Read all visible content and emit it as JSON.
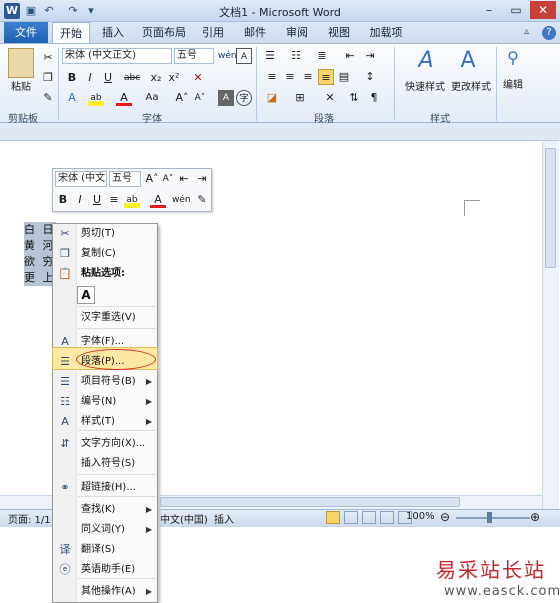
{
  "window": {
    "title": "文档1 - Microsoft Word",
    "quick_access": [
      "save-icon",
      "undo-icon",
      "redo-icon"
    ],
    "controls": [
      "minimize",
      "maximize",
      "close"
    ]
  },
  "tabs": {
    "file": "文件",
    "items": [
      "开始",
      "插入",
      "页面布局",
      "引用",
      "邮件",
      "审阅",
      "视图",
      "加载项"
    ],
    "active": "开始"
  },
  "ribbon": {
    "clipboard": {
      "label": "剪贴板",
      "paste": "粘贴"
    },
    "font": {
      "label": "字体",
      "name": "宋体 (中文正文)",
      "size": "五号"
    },
    "paragraph": {
      "label": "段落"
    },
    "styles": {
      "label": "样式",
      "quick": "快速样式",
      "change": "更改样式"
    },
    "editing": {
      "label": "编辑"
    }
  },
  "document": {
    "lines": [
      "白 日",
      "黄 河",
      "欲 穷",
      "更 上"
    ]
  },
  "mini_toolbar": {
    "font": "宋体 (中文",
    "size": "五号"
  },
  "context_menu": {
    "items": [
      {
        "label": "剪切(T)",
        "icon": "scissors-icon"
      },
      {
        "label": "复制(C)",
        "icon": "copy-icon"
      },
      {
        "label": "粘贴选项:",
        "icon": "paste-icon"
      },
      {
        "label": "A",
        "icon": "paste-keep-text-icon"
      },
      {
        "label": "汉字重选(V)",
        "icon": ""
      },
      {
        "label": "字体(F)...",
        "icon": "font-icon"
      },
      {
        "label": "段落(P)...",
        "icon": "paragraph-icon"
      },
      {
        "label": "项目符号(B)",
        "icon": "bullets-icon"
      },
      {
        "label": "编号(N)",
        "icon": "numbering-icon"
      },
      {
        "label": "样式(T)",
        "icon": "styles-icon"
      },
      {
        "label": "文字方向(X)...",
        "icon": "text-direction-icon"
      },
      {
        "label": "插入符号(S)",
        "icon": ""
      },
      {
        "label": "超链接(H)...",
        "icon": "hyperlink-icon"
      },
      {
        "label": "查找(K)",
        "icon": ""
      },
      {
        "label": "同义词(Y)",
        "icon": ""
      },
      {
        "label": "翻译(S)",
        "icon": "translate-icon"
      },
      {
        "label": "英语助手(E)",
        "icon": "english-assistant-icon"
      },
      {
        "label": "其他操作(A)",
        "icon": ""
      }
    ]
  },
  "statusbar": {
    "page": "页面: 1/1",
    "language": "中文(中国)",
    "mode": "插入",
    "zoom": "100%"
  },
  "watermark": {
    "text": "易采站长站",
    "url": "www.easck.com"
  }
}
